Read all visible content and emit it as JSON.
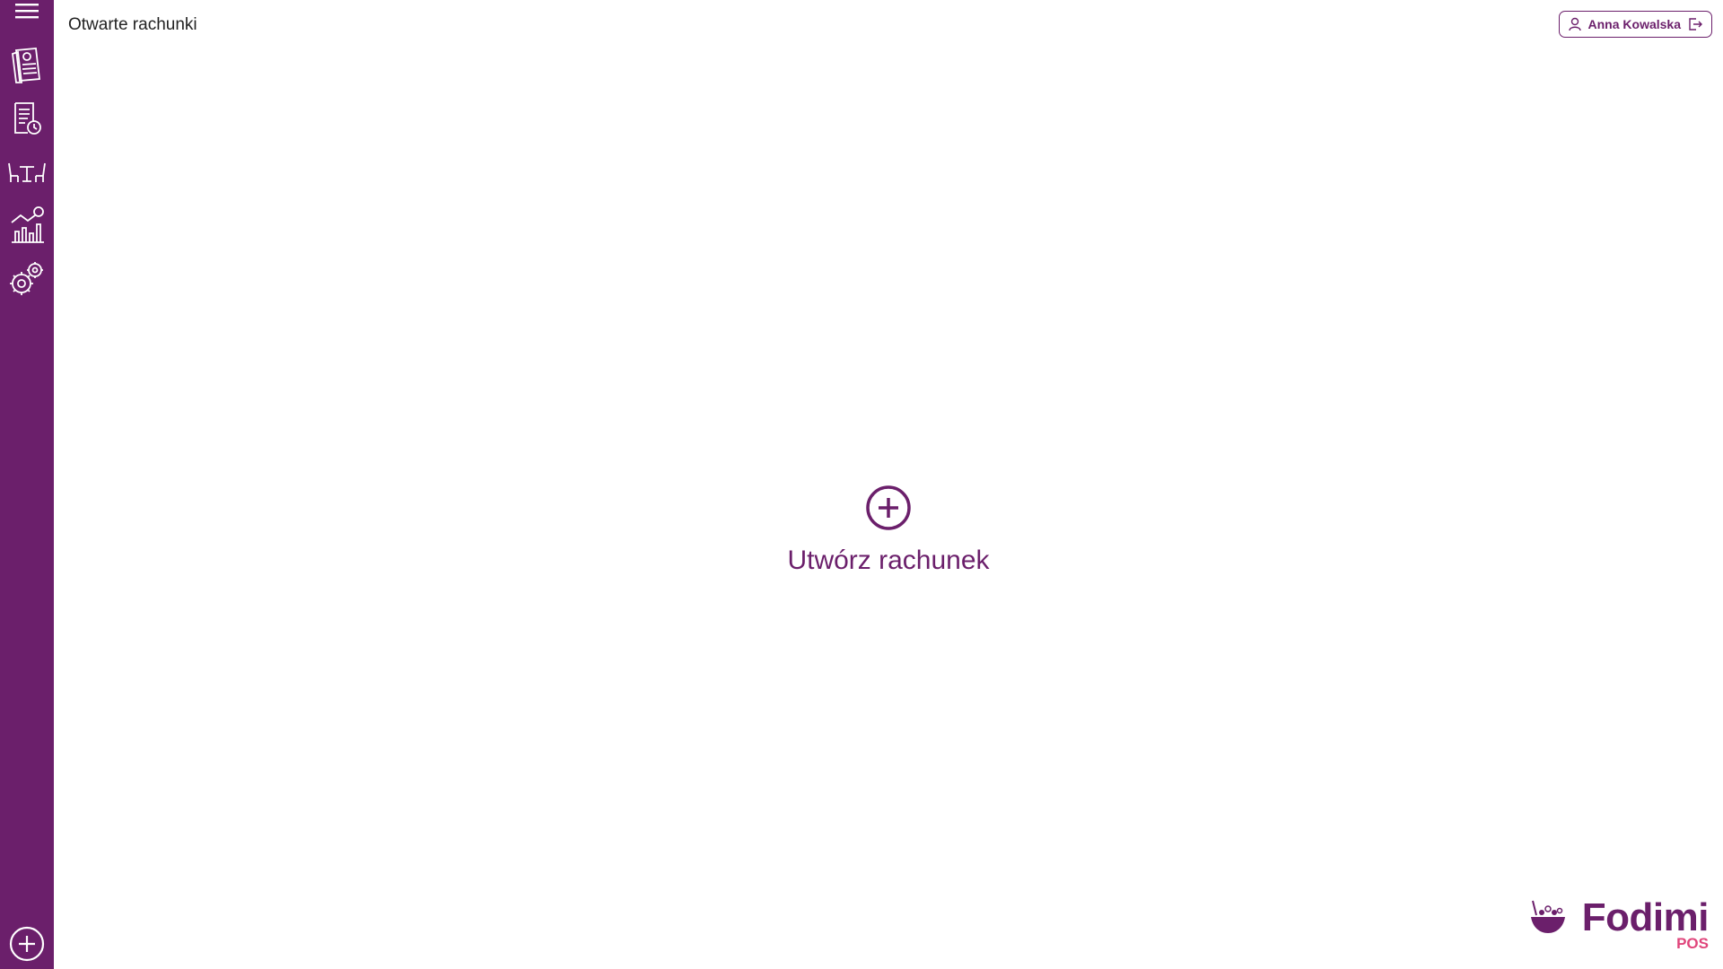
{
  "header": {
    "title": "Otwarte rachunki",
    "user_name": "Anna Kowalska"
  },
  "sidebar": {
    "items": [
      {
        "name": "menu",
        "icon": "hamburger-menu-icon"
      },
      {
        "name": "bills",
        "icon": "bill-document-icon"
      },
      {
        "name": "history",
        "icon": "receipt-history-icon"
      },
      {
        "name": "tables",
        "icon": "tables-icon"
      },
      {
        "name": "reports",
        "icon": "reports-chart-icon"
      },
      {
        "name": "settings",
        "icon": "gear-icon"
      },
      {
        "name": "add",
        "icon": "plus-circle-icon"
      }
    ]
  },
  "main": {
    "create_label": "Utwórz rachunek"
  },
  "brand": {
    "name": "Fodimi",
    "suffix": "POS"
  },
  "colors": {
    "primary": "#6b1f6b",
    "accent": "#e0457b",
    "background": "#ffffff"
  }
}
